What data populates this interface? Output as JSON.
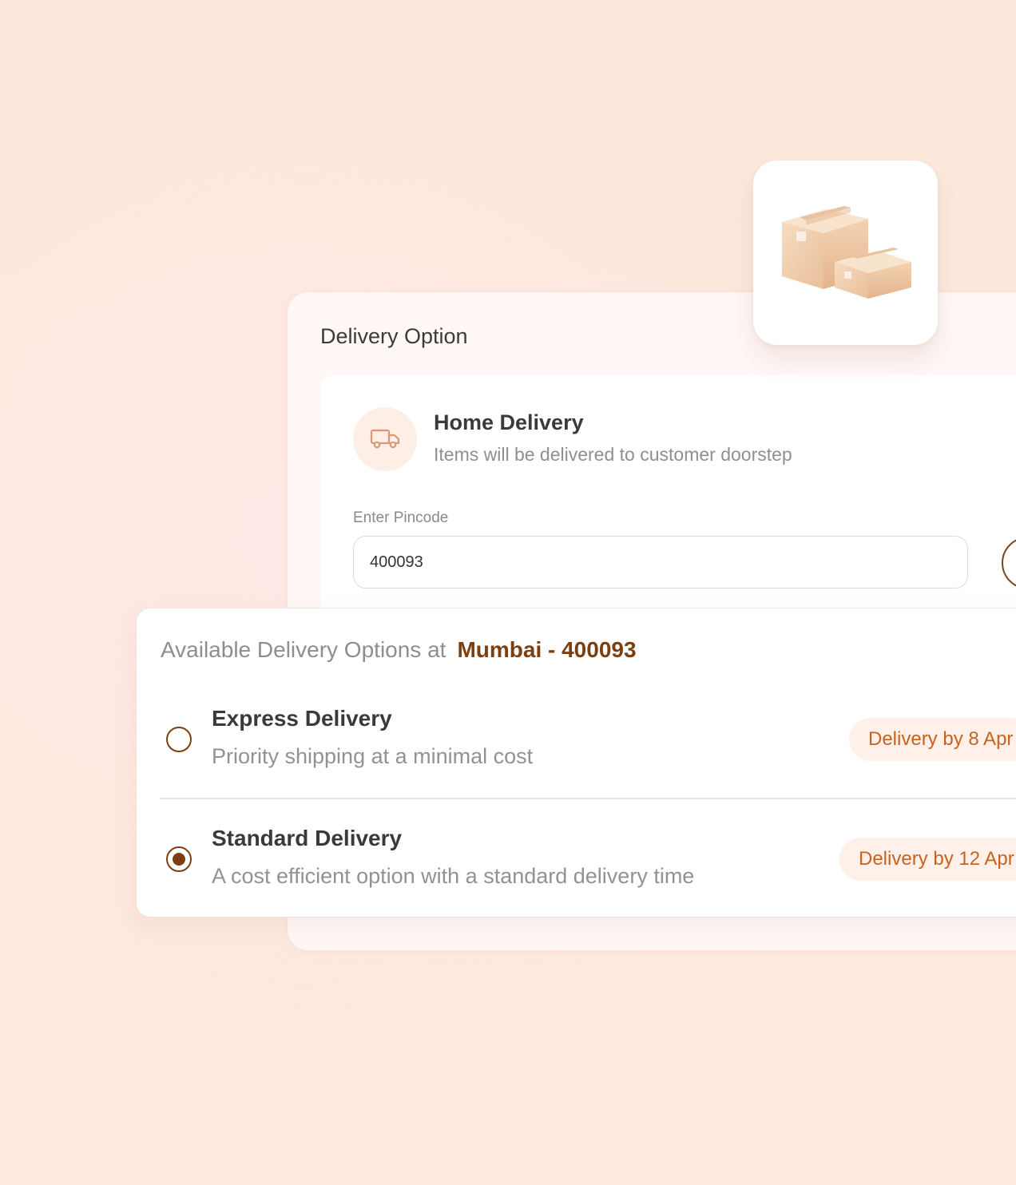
{
  "delivery_option": {
    "title": "Delivery Option",
    "home_delivery": {
      "title": "Home Delivery",
      "description": "Items will be delivered to customer doorstep",
      "icon": "truck-icon"
    },
    "pincode": {
      "label": "Enter Pincode",
      "value": "400093"
    }
  },
  "box_tile": {
    "icon": "package-boxes-icon"
  },
  "available": {
    "prefix": "Available Delivery Options at",
    "location": "Mumbai - 400093",
    "options": [
      {
        "title": "Express Delivery",
        "description": "Priority shipping at a minimal cost",
        "eta": "Delivery by 8 Apr",
        "selected": false
      },
      {
        "title": "Standard Delivery",
        "description": "A cost efficient option with a standard delivery time",
        "eta": "Delivery by 12 Apr",
        "selected": true
      }
    ]
  },
  "colors": {
    "brand": "#7b3f12",
    "accent": "#c8631f",
    "pill_bg": "#fff1ea",
    "background": "#fde8dc"
  }
}
